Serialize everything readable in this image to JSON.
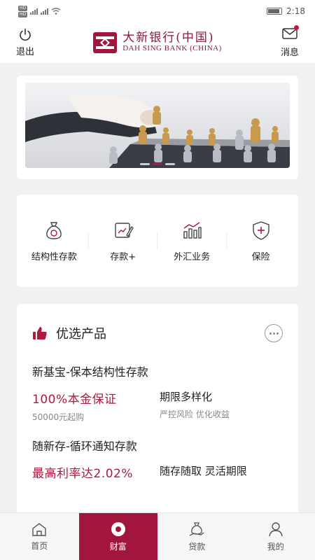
{
  "status_bar": {
    "network_labels": [
      "HD",
      "HD"
    ],
    "time": "2:18"
  },
  "header": {
    "logout_label": "退出",
    "bank_name_cn": "大新银行(中国)",
    "bank_name_en": "DAH SING BANK (CHINA)",
    "messages_label": "消息"
  },
  "banner": {
    "slides": 3,
    "active_slide": 1
  },
  "quick_links": [
    {
      "label": "结构性存款",
      "icon": "money-bag-icon"
    },
    {
      "label": "存款+",
      "icon": "edit-chart-icon"
    },
    {
      "label": "外汇业务",
      "icon": "bar-trend-icon"
    },
    {
      "label": "保险",
      "icon": "shield-plus-icon"
    }
  ],
  "featured": {
    "title": "优选产品",
    "products": [
      {
        "name": "新基宝-保本结构性存款",
        "highlight": "100%本金保证",
        "min_amount": "50000元起购",
        "feature": "期限多样化",
        "feature_sub": "严控风险 优化收益"
      },
      {
        "name": "随新存-循环通知存款",
        "highlight": "最高利率达2.02%",
        "feature": "随存随取 灵活期限"
      }
    ]
  },
  "tabbar": {
    "tabs": [
      {
        "label": "首页",
        "icon": "home-icon"
      },
      {
        "label": "财富",
        "icon": "wealth-icon"
      },
      {
        "label": "贷款",
        "icon": "loan-icon"
      },
      {
        "label": "我的",
        "icon": "profile-icon"
      }
    ],
    "active_index": 1
  },
  "colors": {
    "brand": "#a3163c",
    "accent": "#b0193f"
  }
}
